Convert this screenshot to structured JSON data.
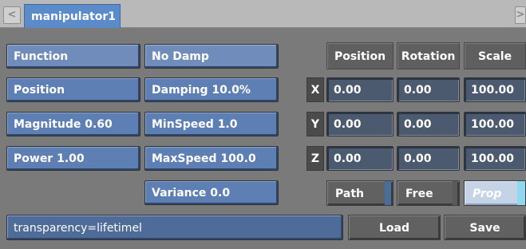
{
  "tab": {
    "label": "manipulator1",
    "left_arrow": "<",
    "right_arrow": ">"
  },
  "left_column": [
    "Function",
    "Position",
    "Magnitude 0.60",
    "Power 1.00"
  ],
  "middle_column": [
    "No Damp",
    "Damping 10.0%",
    "MinSpeed 1.0",
    "MaxSpeed 100.0",
    "Variance 0.0"
  ],
  "headers": [
    "Position",
    "Rotation",
    "Scale"
  ],
  "axes": [
    "X",
    "Y",
    "Z"
  ],
  "values": {
    "x": [
      "0.00",
      "0.00",
      "100.00"
    ],
    "y": [
      "0.00",
      "0.00",
      "100.00"
    ],
    "z": [
      "0.00",
      "0.00",
      "100.00"
    ]
  },
  "modes": [
    "Path",
    "Free",
    "Prop"
  ],
  "expression": "transparency=lifetimel",
  "load_label": "Load",
  "save_label": "Save",
  "colors": {
    "accent_blue": "#5d7fb3",
    "field_dark": "#4c5a70",
    "prop_highlight": "#c4d3e6",
    "prop_indicator": "#8fd8f0"
  }
}
